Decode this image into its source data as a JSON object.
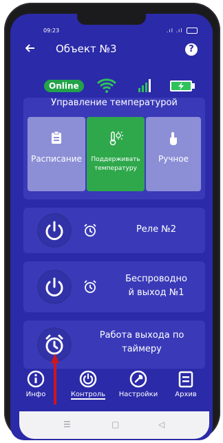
{
  "status_bar": {
    "time": "09:23",
    "icons": ".ıl .ıl"
  },
  "app_bar": {
    "back_icon": "arrow-left-icon",
    "title": "Объект №3",
    "help_label": "?"
  },
  "connection": {
    "online_label": "Online",
    "online_color": "#22a34a",
    "wifi_icon": "wifi-icon",
    "signal_icon": "cell-signal-icon",
    "battery_icon": "battery-charging-icon"
  },
  "temperature": {
    "title": "Управление температурой",
    "modes": [
      {
        "label": "Расписание",
        "icon": "clipboard-icon",
        "active": false
      },
      {
        "label": "Поддерживать температуру",
        "line1": "Поддерживать",
        "line2": "температуру",
        "icon": "thermometer-sun-icon",
        "active": true
      },
      {
        "label": "Ручное",
        "icon": "hand-pointer-icon",
        "active": false
      }
    ]
  },
  "controls": [
    {
      "label": "Реле №2",
      "icons": [
        "power-icon",
        "alarm-clock-icon"
      ]
    },
    {
      "label_line1": "Беспроводно",
      "label_line2": "й выход №1",
      "icons": [
        "power-icon",
        "alarm-clock-icon"
      ]
    },
    {
      "label_line1": "Работа выхода по",
      "label_line2": "таймеру",
      "icons": [
        "alarm-clock-icon"
      ]
    }
  ],
  "bottom_nav": {
    "items": [
      {
        "label": "Инфо",
        "icon": "info-icon"
      },
      {
        "label": "Контроль",
        "icon": "toggle-icon",
        "active": true
      },
      {
        "label": "Настройки",
        "icon": "wrench-icon"
      },
      {
        "label": "Архив",
        "icon": "document-icon"
      }
    ]
  },
  "system_nav": {
    "menu": "☰",
    "home": "▢",
    "back": "◁"
  },
  "colors": {
    "background": "#2b2aa8",
    "card": "#3a3ab8",
    "mode_inactive": "#8c8fd6",
    "mode_active": "#2fa84c",
    "arrow": "#d0161b"
  }
}
